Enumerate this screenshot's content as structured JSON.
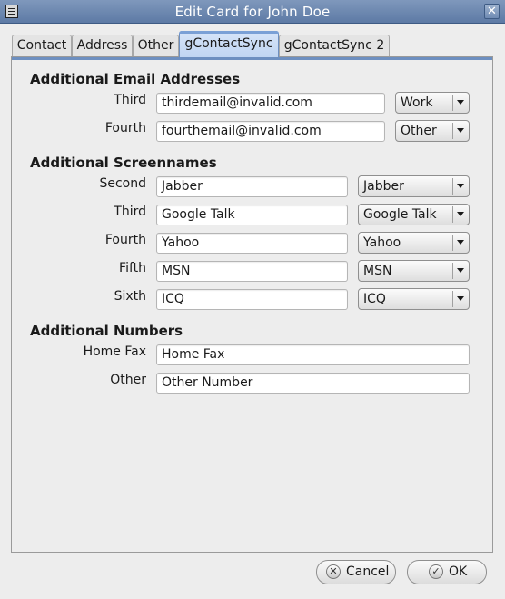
{
  "window": {
    "title": "Edit Card for John Doe",
    "close_glyph": "✕"
  },
  "tabs": [
    {
      "label": "Contact",
      "active": false
    },
    {
      "label": "Address",
      "active": false
    },
    {
      "label": "Other",
      "active": false
    },
    {
      "label": "gContactSync",
      "active": true
    },
    {
      "label": "gContactSync 2",
      "active": false
    }
  ],
  "sections": {
    "emails": {
      "title": "Additional Email Addresses",
      "rows": [
        {
          "label": "Third",
          "value": "thirdemail@invalid.com",
          "type": "Work"
        },
        {
          "label": "Fourth",
          "value": "fourthemail@invalid.com",
          "type": "Other"
        }
      ]
    },
    "screennames": {
      "title": "Additional Screennames",
      "rows": [
        {
          "label": "Second",
          "value": "Jabber",
          "type": "Jabber"
        },
        {
          "label": "Third",
          "value": "Google Talk",
          "type": "Google Talk"
        },
        {
          "label": "Fourth",
          "value": "Yahoo",
          "type": "Yahoo"
        },
        {
          "label": "Fifth",
          "value": "MSN",
          "type": "MSN"
        },
        {
          "label": "Sixth",
          "value": "ICQ",
          "type": "ICQ"
        }
      ]
    },
    "numbers": {
      "title": "Additional Numbers",
      "rows": [
        {
          "label": "Home Fax",
          "value": "Home Fax"
        },
        {
          "label": "Other",
          "value": "Other Number"
        }
      ]
    }
  },
  "buttons": {
    "cancel": {
      "label": "Cancel",
      "icon": "cancel-icon",
      "glyph": "✕"
    },
    "ok": {
      "label": "OK",
      "icon": "checkmark-icon",
      "glyph": "✓"
    }
  },
  "colors": {
    "titlebar": "#6a86ad",
    "active_tab": "#c8daf4",
    "accent": "#6d8fc0"
  }
}
